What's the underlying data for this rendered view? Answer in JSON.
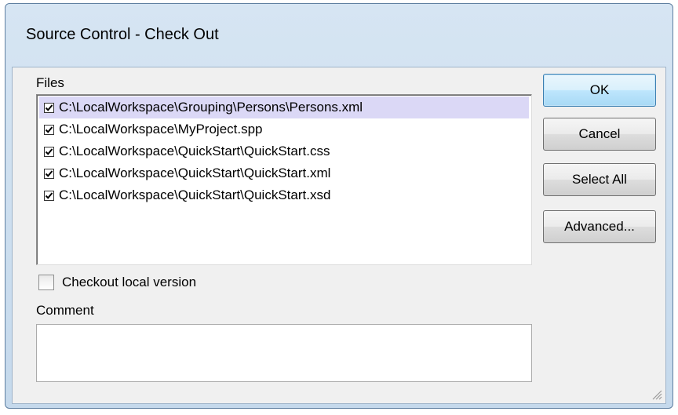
{
  "window": {
    "title": "Source Control - Check Out"
  },
  "files": {
    "label": "Files",
    "items": [
      {
        "path": "C:\\LocalWorkspace\\Grouping\\Persons\\Persons.xml",
        "checked": true,
        "selected": true
      },
      {
        "path": "C:\\LocalWorkspace\\MyProject.spp",
        "checked": true,
        "selected": false
      },
      {
        "path": "C:\\LocalWorkspace\\QuickStart\\QuickStart.css",
        "checked": true,
        "selected": false
      },
      {
        "path": "C:\\LocalWorkspace\\QuickStart\\QuickStart.xml",
        "checked": true,
        "selected": false
      },
      {
        "path": "C:\\LocalWorkspace\\QuickStart\\QuickStart.xsd",
        "checked": true,
        "selected": false
      }
    ]
  },
  "checkout_local": {
    "label": "Checkout local version",
    "checked": false
  },
  "comment": {
    "label": "Comment",
    "value": ""
  },
  "buttons": {
    "ok": "OK",
    "cancel": "Cancel",
    "select_all": "Select All",
    "advanced": "Advanced..."
  },
  "colors": {
    "selection": "#dbd8f6",
    "title_gradient_top": "#d6e5f3",
    "default_button_border": "#3c7fb1"
  }
}
